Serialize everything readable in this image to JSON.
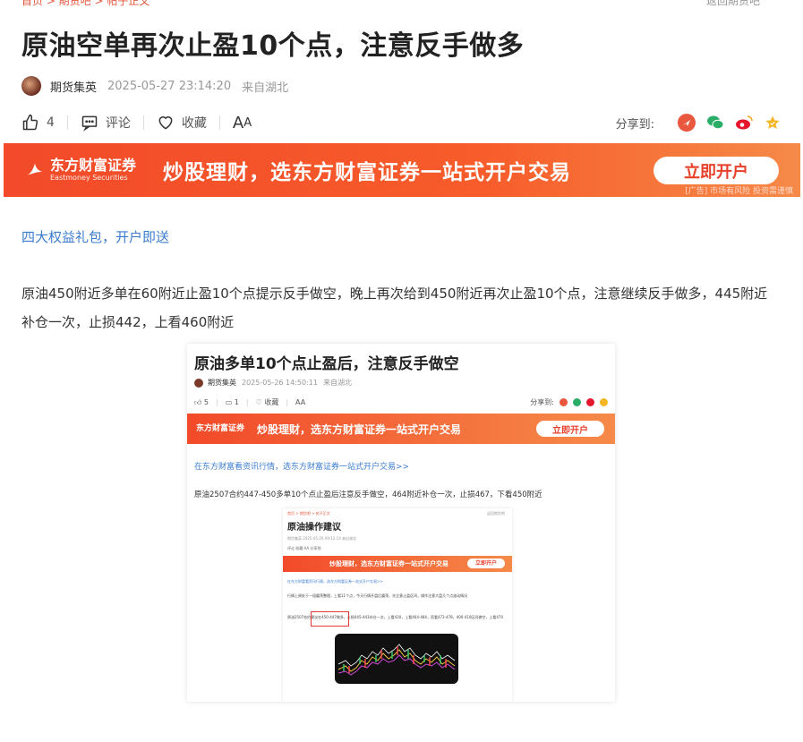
{
  "top_partial": {
    "left": "首页 > 期货吧 > 帖子正文",
    "right": "返回期货吧"
  },
  "article": {
    "title": "原油空单再次止盈10个点，注意反手做多",
    "author": "期货集英",
    "time": "2025-05-27 23:14:20",
    "location": "来自湖北"
  },
  "toolbar": {
    "like_count": "4",
    "comment_label": "评论",
    "favorite_label": "收藏",
    "font_big": "A",
    "font_small": "A",
    "share_label": "分享到:"
  },
  "share_icons": [
    {
      "name": "shouji-share-icon",
      "color": "#e9573f",
      "glyph": "◢"
    },
    {
      "name": "wechat-icon",
      "color": "#2aae67",
      "glyph": "●"
    },
    {
      "name": "weibo-icon",
      "color": "#e6162d",
      "glyph": "◉"
    },
    {
      "name": "favorite-star-icon",
      "color": "#f5b623",
      "glyph": "★"
    }
  ],
  "banner": {
    "logo_cn": "东方财富证券",
    "logo_en": "Eastmoney Securities",
    "slogan": "炒股理财，选东方财富证券一站式开户交易",
    "cta": "立即开户",
    "ad_note": "[广告] 市场有风险 投资需谨慎"
  },
  "promo_link": "四大权益礼包，开户即送",
  "body": "原油450附近多单在60附近止盈10个点提示反手做空，晚上再次给到450附近再次止盈10个点，注意继续反手做多，445附近补仓一次，止损442，上看460附近",
  "shot1": {
    "title": "原油多单10个点止盈后，注意反手做空",
    "author": "期货集英",
    "time": "2025-05-26 14:50:11",
    "location": "来自湖北",
    "likes": "5",
    "comments": "1",
    "favorite_label": "收藏",
    "font_label": "AA",
    "share_label": "分享到:",
    "banner_logo": "东方财富证券",
    "banner_slogan": "炒股理财，选东方财富证券一站式开户交易",
    "banner_cta": "立即开户",
    "link": "在东方财富看资讯行情，选东方财富证券一站式开户交易>>",
    "text": "原油2507合约447-450多单10个点止盈后注意反手做空，464附近补仓一次，止损467，下看450附近"
  },
  "shot2": {
    "crumb": "首页 > 期货吧 > 帖子正文",
    "back": "返回期货吧",
    "title": "原油操作建议",
    "meta": "期货集英  2025-05-26 09:12:14  来自湖北",
    "tools": "评论  收藏  AA                                                      分享到:",
    "banner_slogan": "炒股理财，选东方财富证券一站式开户交易",
    "banner_cta": "立即开户",
    "link": "在东方财富看资讯行情，选东方财富证券一站式开户交易>>",
    "p1": "行情上周处于一段震荡整理，上看11个点，今天行情开盘后震荡，先注意止盈区间，操作注意大盘几个点波动情况",
    "p2": "原油2507合约建议在450-447做多，止损445-443补仓一次，上看430，上看464-484，而看473-478，400-410区间做空，上看470"
  },
  "colors": {
    "accent": "#f24a2a",
    "link": "#3b7ccf",
    "highlight": "#e53935"
  }
}
